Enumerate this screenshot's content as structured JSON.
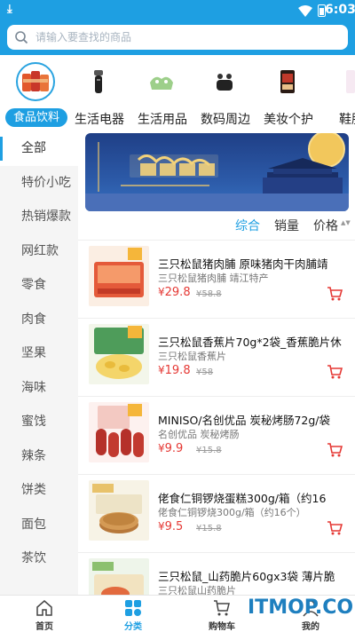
{
  "status_bar": {
    "time": "6:03",
    "download_glyph": "⤓"
  },
  "search": {
    "placeholder": "请输入要查找的商品"
  },
  "categories": [
    {
      "label": "食品饮料",
      "selected": true,
      "icon": "snack-bag-icon"
    },
    {
      "label": "生活电器",
      "selected": false,
      "icon": "shaver-icon"
    },
    {
      "label": "生活用品",
      "selected": false,
      "icon": "towel-icon"
    },
    {
      "label": "数码周边",
      "selected": false,
      "icon": "earbuds-icon"
    },
    {
      "label": "美妆个护",
      "selected": false,
      "icon": "cosmetics-box-icon"
    },
    {
      "label": "鞋服",
      "selected": false,
      "icon": "apparel-icon"
    }
  ],
  "sidebar": {
    "items": [
      "全部",
      "特价小吃",
      "热销爆款",
      "网红款",
      "零食",
      "肉食",
      "坚果",
      "海味",
      "蜜饯",
      "辣条",
      "饼类",
      "面包",
      "茶饮"
    ],
    "selected_index": 0
  },
  "sort": {
    "composite": "综合",
    "sales": "销量",
    "price": "价格",
    "arrows": "▲▼"
  },
  "products": [
    {
      "name": "三只松鼠猪肉脯 原味猪肉干肉脯靖",
      "sub": "三只松鼠猪肉脯 靖江特产",
      "price": "29.8",
      "orig": "¥58.8",
      "currency": "¥",
      "image": "pork-jerky-image"
    },
    {
      "name": "三只松鼠香蕉片70g*2袋_香蕉脆片休",
      "sub": "三只松鼠香蕉片",
      "price": "19.8",
      "orig": "¥58",
      "currency": "¥",
      "image": "banana-chips-image"
    },
    {
      "name": "MINISO/名创优品 炭秘烤肠72g/袋",
      "sub": "名创优品 炭秘烤肠",
      "price": "9.9",
      "orig": "¥15.8",
      "currency": "¥",
      "image": "sausage-image"
    },
    {
      "name": "佬食仁铜锣烧蛋糕300g/箱（约16",
      "sub": "佬食仁铜锣烧300g/箱（约16个）",
      "price": "9.5",
      "orig": "¥15.8",
      "currency": "¥",
      "image": "dorayaki-image"
    },
    {
      "name": "三只松鼠_山药脆片60gx3袋 薄片脆",
      "sub": "三只松鼠山药脆片",
      "price": "",
      "orig": "",
      "currency": "",
      "image": "yam-chips-image"
    }
  ],
  "tabbar": [
    {
      "label": "首页",
      "icon": "home-icon",
      "active": false
    },
    {
      "label": "分类",
      "icon": "category-grid-icon",
      "active": true
    },
    {
      "label": "购物车",
      "icon": "cart-icon",
      "active": false
    },
    {
      "label": "我的",
      "icon": "user-icon",
      "active": false
    }
  ],
  "watermark": "ITMOP.COM",
  "colors": {
    "accent": "#1e9fe2",
    "price": "#e53935"
  }
}
